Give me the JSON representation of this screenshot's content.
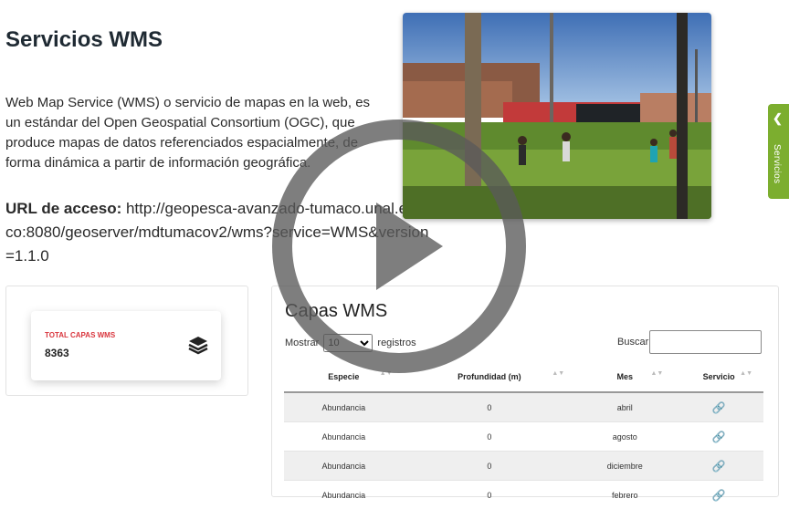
{
  "page": {
    "title": "Servicios WMS",
    "description": "Web Map Service (WMS) o servicio de mapas en la web, es un estándar del Open Geospatial Consortium (OGC), que produce mapas de datos referenciados espacialmente, de forma dinámica a partir de información geográfica.",
    "url_label": "URL de acceso:",
    "url_value": "http://geopesca-avanzado-tumaco.unal.edu.co:8080/geoserver/mdtumacov2/wms?service=WMS&version=1.1.0"
  },
  "side_tab": {
    "label": "Servicios",
    "icon": "chevron-left-icon",
    "color": "#7cae2f"
  },
  "stat_card": {
    "label": "TOTAL CAPAS WMS",
    "value": "8363",
    "icon": "layers-icon",
    "label_color": "#d9363e"
  },
  "table_panel": {
    "title": "Capas WMS",
    "show_prefix": "Mostrar",
    "page_size": "10",
    "page_size_options": [
      "10"
    ],
    "show_suffix": "registros",
    "search_label": "Buscar:",
    "search_value": "",
    "columns": [
      "Especie",
      "Profundidad (m)",
      "Mes",
      "Servicio"
    ],
    "rows": [
      {
        "especie": "Abundancia",
        "profundidad": "0",
        "mes": "abril",
        "servicio": "link-icon"
      },
      {
        "especie": "Abundancia",
        "profundidad": "0",
        "mes": "agosto",
        "servicio": "link-icon"
      },
      {
        "especie": "Abundancia",
        "profundidad": "0",
        "mes": "diciembre",
        "servicio": "link-icon"
      },
      {
        "especie": "Abundancia",
        "profundidad": "0",
        "mes": "febrero",
        "servicio": "link-icon"
      }
    ]
  },
  "overlay": {
    "icon": "play-icon"
  }
}
